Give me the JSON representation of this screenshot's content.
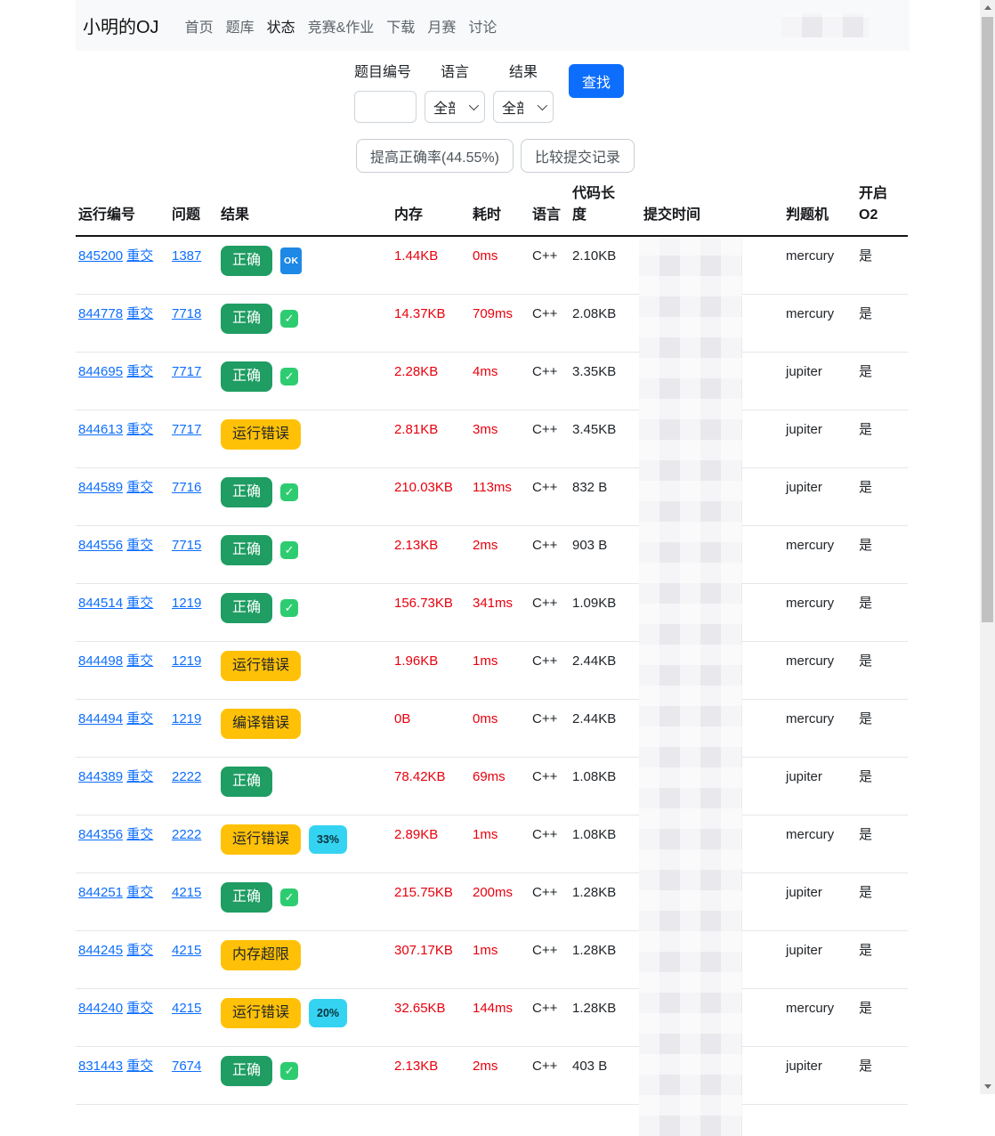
{
  "colors": {
    "accent": "#0d6efd",
    "link": "#0d6efd",
    "success": "#1f9d63",
    "check_green": "#2dcc70",
    "ok_blue": "#1d88e5",
    "warning": "#ffc107",
    "info": "#35d3f2",
    "danger": "#e8000d"
  },
  "navbar": {
    "brand": "小明的OJ",
    "items": [
      {
        "key": "home",
        "label": "首页",
        "active": false
      },
      {
        "key": "problems",
        "label": "题库",
        "active": false
      },
      {
        "key": "status",
        "label": "状态",
        "active": true
      },
      {
        "key": "contests",
        "label": "竞赛&作业",
        "active": false
      },
      {
        "key": "download",
        "label": "下载",
        "active": false
      },
      {
        "key": "monthly",
        "label": "月赛",
        "active": false
      },
      {
        "key": "discuss",
        "label": "讨论",
        "active": false
      }
    ]
  },
  "filters": {
    "problem_id": {
      "label": "题目编号",
      "value": ""
    },
    "language": {
      "label": "语言",
      "value": "全部"
    },
    "result": {
      "label": "结果",
      "value": "全部"
    },
    "search_label": "查找"
  },
  "actions": {
    "improve": "提高正确率(44.55%)",
    "compare": "比较提交记录"
  },
  "table": {
    "columns": [
      "运行编号",
      "问题",
      "结果",
      "内存",
      "耗时",
      "语言",
      "代码长度",
      "提交时间",
      "判题机",
      "开启O2"
    ],
    "rows": [
      {
        "run_id": "845200",
        "resubmit": "重交",
        "problem": "1387",
        "result": {
          "label": "正确",
          "type": "success"
        },
        "mark": {
          "type": "ok",
          "label": "OK"
        },
        "memory": "1.44KB",
        "time": "0ms",
        "language": "C++",
        "code_length": "2.10KB",
        "judger": "mercury",
        "o2": "是"
      },
      {
        "run_id": "844778",
        "resubmit": "重交",
        "problem": "7718",
        "result": {
          "label": "正确",
          "type": "success"
        },
        "mark": {
          "type": "check",
          "label": "✓"
        },
        "memory": "14.37KB",
        "time": "709ms",
        "language": "C++",
        "code_length": "2.08KB",
        "judger": "mercury",
        "o2": "是"
      },
      {
        "run_id": "844695",
        "resubmit": "重交",
        "problem": "7717",
        "result": {
          "label": "正确",
          "type": "success"
        },
        "mark": {
          "type": "check",
          "label": "✓"
        },
        "memory": "2.28KB",
        "time": "4ms",
        "language": "C++",
        "code_length": "3.35KB",
        "judger": "jupiter",
        "o2": "是"
      },
      {
        "run_id": "844613",
        "resubmit": "重交",
        "problem": "7717",
        "result": {
          "label": "运行错误",
          "type": "warning"
        },
        "mark": null,
        "memory": "2.81KB",
        "time": "3ms",
        "language": "C++",
        "code_length": "3.45KB",
        "judger": "jupiter",
        "o2": "是"
      },
      {
        "run_id": "844589",
        "resubmit": "重交",
        "problem": "7716",
        "result": {
          "label": "正确",
          "type": "success"
        },
        "mark": {
          "type": "check",
          "label": "✓"
        },
        "memory": "210.03KB",
        "time": "113ms",
        "language": "C++",
        "code_length": "832 B",
        "judger": "jupiter",
        "o2": "是"
      },
      {
        "run_id": "844556",
        "resubmit": "重交",
        "problem": "7715",
        "result": {
          "label": "正确",
          "type": "success"
        },
        "mark": {
          "type": "check",
          "label": "✓"
        },
        "memory": "2.13KB",
        "time": "2ms",
        "language": "C++",
        "code_length": "903 B",
        "judger": "mercury",
        "o2": "是"
      },
      {
        "run_id": "844514",
        "resubmit": "重交",
        "problem": "1219",
        "result": {
          "label": "正确",
          "type": "success"
        },
        "mark": {
          "type": "check",
          "label": "✓"
        },
        "memory": "156.73KB",
        "time": "341ms",
        "language": "C++",
        "code_length": "1.09KB",
        "judger": "mercury",
        "o2": "是"
      },
      {
        "run_id": "844498",
        "resubmit": "重交",
        "problem": "1219",
        "result": {
          "label": "运行错误",
          "type": "warning"
        },
        "mark": null,
        "memory": "1.96KB",
        "time": "1ms",
        "language": "C++",
        "code_length": "2.44KB",
        "judger": "mercury",
        "o2": "是"
      },
      {
        "run_id": "844494",
        "resubmit": "重交",
        "problem": "1219",
        "result": {
          "label": "编译错误",
          "type": "warning"
        },
        "mark": null,
        "memory": "0B",
        "time": "0ms",
        "language": "C++",
        "code_length": "2.44KB",
        "judger": "mercury",
        "o2": "是"
      },
      {
        "run_id": "844389",
        "resubmit": "重交",
        "problem": "2222",
        "result": {
          "label": "正确",
          "type": "success"
        },
        "mark": null,
        "memory": "78.42KB",
        "time": "69ms",
        "language": "C++",
        "code_length": "1.08KB",
        "judger": "jupiter",
        "o2": "是"
      },
      {
        "run_id": "844356",
        "resubmit": "重交",
        "problem": "2222",
        "result": {
          "label": "运行错误",
          "type": "warning"
        },
        "mark": {
          "type": "percent",
          "label": "33%"
        },
        "memory": "2.89KB",
        "time": "1ms",
        "language": "C++",
        "code_length": "1.08KB",
        "judger": "mercury",
        "o2": "是"
      },
      {
        "run_id": "844251",
        "resubmit": "重交",
        "problem": "4215",
        "result": {
          "label": "正确",
          "type": "success"
        },
        "mark": {
          "type": "check",
          "label": "✓"
        },
        "memory": "215.75KB",
        "time": "200ms",
        "language": "C++",
        "code_length": "1.28KB",
        "judger": "jupiter",
        "o2": "是"
      },
      {
        "run_id": "844245",
        "resubmit": "重交",
        "problem": "4215",
        "result": {
          "label": "内存超限",
          "type": "warning"
        },
        "mark": null,
        "memory": "307.17KB",
        "time": "1ms",
        "language": "C++",
        "code_length": "1.28KB",
        "judger": "jupiter",
        "o2": "是"
      },
      {
        "run_id": "844240",
        "resubmit": "重交",
        "problem": "4215",
        "result": {
          "label": "运行错误",
          "type": "warning"
        },
        "mark": {
          "type": "percent",
          "label": "20%"
        },
        "memory": "32.65KB",
        "time": "144ms",
        "language": "C++",
        "code_length": "1.28KB",
        "judger": "mercury",
        "o2": "是"
      },
      {
        "run_id": "831443",
        "resubmit": "重交",
        "problem": "7674",
        "result": {
          "label": "正确",
          "type": "success"
        },
        "mark": {
          "type": "check",
          "label": "✓"
        },
        "memory": "2.13KB",
        "time": "2ms",
        "language": "C++",
        "code_length": "403 B",
        "judger": "jupiter",
        "o2": "是"
      }
    ]
  }
}
